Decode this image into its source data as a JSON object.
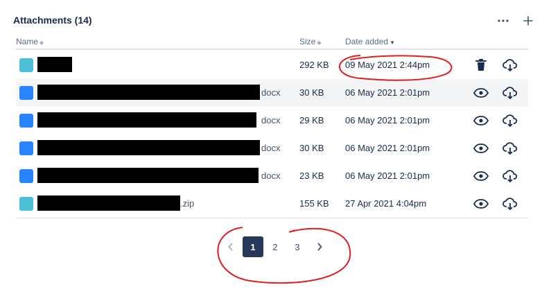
{
  "header": {
    "title": "Attachments (14)",
    "more_icon": "more-horizontal-icon",
    "add_icon": "plus-icon"
  },
  "columns": {
    "name": "Name",
    "size": "Size",
    "date": "Date added"
  },
  "rows": [
    {
      "type": "zip",
      "ext": "",
      "size": "292 KB",
      "date": "09 May 2021 2:44pm",
      "actions": [
        "delete-icon",
        "download-icon"
      ]
    },
    {
      "type": "doc",
      "ext": "docx",
      "size": "30 KB",
      "date": "06 May 2021 2:01pm",
      "actions": [
        "preview-icon",
        "download-icon"
      ]
    },
    {
      "type": "doc",
      "ext": "docx",
      "size": "29 KB",
      "date": "06 May 2021 2:01pm",
      "actions": [
        "preview-icon",
        "download-icon"
      ]
    },
    {
      "type": "doc",
      "ext": "docx",
      "size": "30 KB",
      "date": "06 May 2021 2:01pm",
      "actions": [
        "preview-icon",
        "download-icon"
      ]
    },
    {
      "type": "doc",
      "ext": "docx",
      "size": "23 KB",
      "date": "06 May 2021 2:01pm",
      "actions": [
        "preview-icon",
        "download-icon"
      ]
    },
    {
      "type": "zip",
      "ext": ".zip",
      "size": "155 KB",
      "date": "27 Apr 2021 4:04pm",
      "actions": [
        "preview-icon",
        "download-icon"
      ]
    }
  ],
  "pagination": {
    "prev_icon": "chevron-left-icon",
    "pages": [
      "1",
      "2",
      "3"
    ],
    "current": "1",
    "next_icon": "chevron-right-icon"
  },
  "colors": {
    "zip_icon": "#4bc0d6",
    "doc_icon": "#2684ff",
    "current_page": "#253858",
    "annotation": "#e01e1e"
  }
}
